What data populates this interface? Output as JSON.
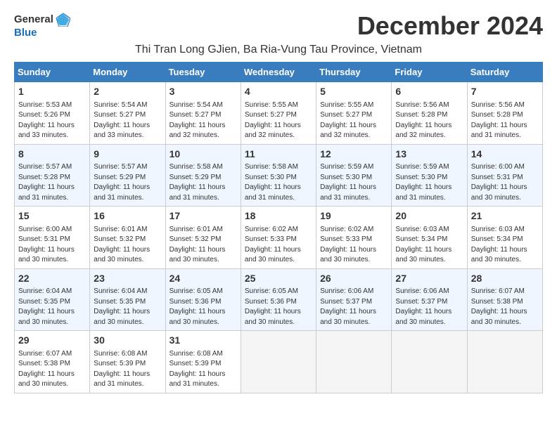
{
  "header": {
    "logo_general": "General",
    "logo_blue": "Blue",
    "month_title": "December 2024",
    "location": "Thi Tran Long GJien, Ba Ria-Vung Tau Province, Vietnam"
  },
  "days_of_week": [
    "Sunday",
    "Monday",
    "Tuesday",
    "Wednesday",
    "Thursday",
    "Friday",
    "Saturday"
  ],
  "weeks": [
    [
      {
        "day": "1",
        "info": "Sunrise: 5:53 AM\nSunset: 5:26 PM\nDaylight: 11 hours\nand 33 minutes."
      },
      {
        "day": "2",
        "info": "Sunrise: 5:54 AM\nSunset: 5:27 PM\nDaylight: 11 hours\nand 33 minutes."
      },
      {
        "day": "3",
        "info": "Sunrise: 5:54 AM\nSunset: 5:27 PM\nDaylight: 11 hours\nand 32 minutes."
      },
      {
        "day": "4",
        "info": "Sunrise: 5:55 AM\nSunset: 5:27 PM\nDaylight: 11 hours\nand 32 minutes."
      },
      {
        "day": "5",
        "info": "Sunrise: 5:55 AM\nSunset: 5:27 PM\nDaylight: 11 hours\nand 32 minutes."
      },
      {
        "day": "6",
        "info": "Sunrise: 5:56 AM\nSunset: 5:28 PM\nDaylight: 11 hours\nand 32 minutes."
      },
      {
        "day": "7",
        "info": "Sunrise: 5:56 AM\nSunset: 5:28 PM\nDaylight: 11 hours\nand 31 minutes."
      }
    ],
    [
      {
        "day": "8",
        "info": "Sunrise: 5:57 AM\nSunset: 5:28 PM\nDaylight: 11 hours\nand 31 minutes."
      },
      {
        "day": "9",
        "info": "Sunrise: 5:57 AM\nSunset: 5:29 PM\nDaylight: 11 hours\nand 31 minutes."
      },
      {
        "day": "10",
        "info": "Sunrise: 5:58 AM\nSunset: 5:29 PM\nDaylight: 11 hours\nand 31 minutes."
      },
      {
        "day": "11",
        "info": "Sunrise: 5:58 AM\nSunset: 5:30 PM\nDaylight: 11 hours\nand 31 minutes."
      },
      {
        "day": "12",
        "info": "Sunrise: 5:59 AM\nSunset: 5:30 PM\nDaylight: 11 hours\nand 31 minutes."
      },
      {
        "day": "13",
        "info": "Sunrise: 5:59 AM\nSunset: 5:30 PM\nDaylight: 11 hours\nand 31 minutes."
      },
      {
        "day": "14",
        "info": "Sunrise: 6:00 AM\nSunset: 5:31 PM\nDaylight: 11 hours\nand 30 minutes."
      }
    ],
    [
      {
        "day": "15",
        "info": "Sunrise: 6:00 AM\nSunset: 5:31 PM\nDaylight: 11 hours\nand 30 minutes."
      },
      {
        "day": "16",
        "info": "Sunrise: 6:01 AM\nSunset: 5:32 PM\nDaylight: 11 hours\nand 30 minutes."
      },
      {
        "day": "17",
        "info": "Sunrise: 6:01 AM\nSunset: 5:32 PM\nDaylight: 11 hours\nand 30 minutes."
      },
      {
        "day": "18",
        "info": "Sunrise: 6:02 AM\nSunset: 5:33 PM\nDaylight: 11 hours\nand 30 minutes."
      },
      {
        "day": "19",
        "info": "Sunrise: 6:02 AM\nSunset: 5:33 PM\nDaylight: 11 hours\nand 30 minutes."
      },
      {
        "day": "20",
        "info": "Sunrise: 6:03 AM\nSunset: 5:34 PM\nDaylight: 11 hours\nand 30 minutes."
      },
      {
        "day": "21",
        "info": "Sunrise: 6:03 AM\nSunset: 5:34 PM\nDaylight: 11 hours\nand 30 minutes."
      }
    ],
    [
      {
        "day": "22",
        "info": "Sunrise: 6:04 AM\nSunset: 5:35 PM\nDaylight: 11 hours\nand 30 minutes."
      },
      {
        "day": "23",
        "info": "Sunrise: 6:04 AM\nSunset: 5:35 PM\nDaylight: 11 hours\nand 30 minutes."
      },
      {
        "day": "24",
        "info": "Sunrise: 6:05 AM\nSunset: 5:36 PM\nDaylight: 11 hours\nand 30 minutes."
      },
      {
        "day": "25",
        "info": "Sunrise: 6:05 AM\nSunset: 5:36 PM\nDaylight: 11 hours\nand 30 minutes."
      },
      {
        "day": "26",
        "info": "Sunrise: 6:06 AM\nSunset: 5:37 PM\nDaylight: 11 hours\nand 30 minutes."
      },
      {
        "day": "27",
        "info": "Sunrise: 6:06 AM\nSunset: 5:37 PM\nDaylight: 11 hours\nand 30 minutes."
      },
      {
        "day": "28",
        "info": "Sunrise: 6:07 AM\nSunset: 5:38 PM\nDaylight: 11 hours\nand 30 minutes."
      }
    ],
    [
      {
        "day": "29",
        "info": "Sunrise: 6:07 AM\nSunset: 5:38 PM\nDaylight: 11 hours\nand 30 minutes."
      },
      {
        "day": "30",
        "info": "Sunrise: 6:08 AM\nSunset: 5:39 PM\nDaylight: 11 hours\nand 31 minutes."
      },
      {
        "day": "31",
        "info": "Sunrise: 6:08 AM\nSunset: 5:39 PM\nDaylight: 11 hours\nand 31 minutes."
      },
      {
        "day": "",
        "info": ""
      },
      {
        "day": "",
        "info": ""
      },
      {
        "day": "",
        "info": ""
      },
      {
        "day": "",
        "info": ""
      }
    ]
  ]
}
